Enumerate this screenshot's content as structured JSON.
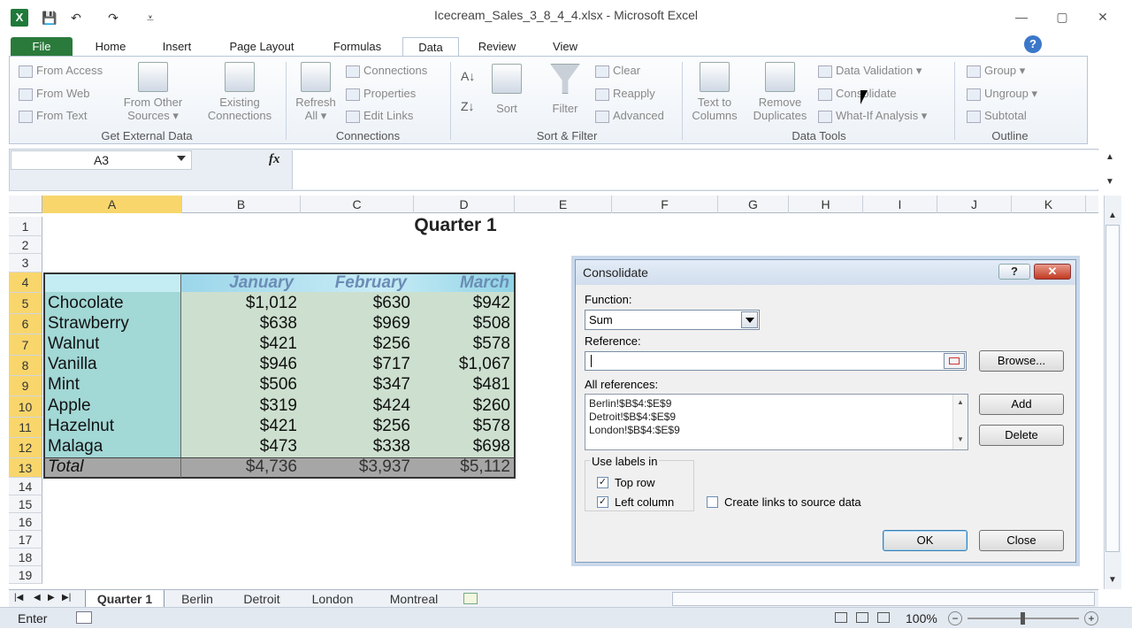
{
  "window": {
    "title": "Icecream_Sales_3_8_4_4.xlsx - Microsoft Excel",
    "minimize": "—",
    "maximize": "▢",
    "close": "✕"
  },
  "quick_access": {
    "save": "💾",
    "undo": "↶",
    "redo": "↷",
    "customize": "⩡"
  },
  "tabs": [
    "File",
    "Home",
    "Insert",
    "Page Layout",
    "Formulas",
    "Data",
    "Review",
    "View"
  ],
  "active_tab": "Data",
  "ribbon": {
    "get_external": {
      "items": [
        "From Access",
        "From Web",
        "From Text"
      ],
      "big1": [
        "From Other",
        "Sources ▾"
      ],
      "big2": [
        "Existing",
        "Connections"
      ],
      "label": "Get External Data"
    },
    "connections": {
      "big": [
        "Refresh",
        "All ▾"
      ],
      "items": [
        "Connections",
        "Properties",
        "Edit Links"
      ],
      "label": "Connections"
    },
    "sort_filter": {
      "sort": "Sort",
      "filter": "Filter",
      "items": [
        "Clear",
        "Reapply",
        "Advanced"
      ],
      "label": "Sort & Filter"
    },
    "data_tools": {
      "big1": [
        "Text to",
        "Columns"
      ],
      "big2": [
        "Remove",
        "Duplicates"
      ],
      "items": [
        "Data Validation ▾",
        "Consolidate",
        "What-If Analysis ▾"
      ],
      "label": "Data Tools"
    },
    "outline": {
      "items": [
        "Group ▾",
        "Ungroup ▾",
        "Subtotal"
      ],
      "label": "Outline"
    }
  },
  "formula_bar": {
    "name_box": "A3",
    "fx": "fx",
    "value": ""
  },
  "columns": [
    "A",
    "B",
    "C",
    "D",
    "E",
    "F",
    "G",
    "H",
    "I",
    "J",
    "K"
  ],
  "rows": [
    "1",
    "2",
    "3",
    "4",
    "5",
    "6",
    "7",
    "8",
    "9",
    "10",
    "11",
    "12",
    "13",
    "14",
    "15",
    "16",
    "17",
    "18",
    "19"
  ],
  "sheet": {
    "title": "Quarter 1",
    "headers": [
      "January",
      "February",
      "March"
    ],
    "data": [
      {
        "name": "Chocolate",
        "jan": "$1,012",
        "feb": "$630",
        "mar": "$942"
      },
      {
        "name": "Strawberry",
        "jan": "$638",
        "feb": "$969",
        "mar": "$508"
      },
      {
        "name": "Walnut",
        "jan": "$421",
        "feb": "$256",
        "mar": "$578"
      },
      {
        "name": "Vanilla",
        "jan": "$946",
        "feb": "$717",
        "mar": "$1,067"
      },
      {
        "name": "Mint",
        "jan": "$506",
        "feb": "$347",
        "mar": "$481"
      },
      {
        "name": "Apple",
        "jan": "$319",
        "feb": "$424",
        "mar": "$260"
      },
      {
        "name": "Hazelnut",
        "jan": "$421",
        "feb": "$256",
        "mar": "$578"
      },
      {
        "name": "Malaga",
        "jan": "$473",
        "feb": "$338",
        "mar": "$698"
      }
    ],
    "total": {
      "name": "Total",
      "jan": "$4,736",
      "feb": "$3,937",
      "mar": "$5,112"
    }
  },
  "sheet_tabs": [
    "Quarter 1",
    "Berlin",
    "Detroit",
    "London",
    "Montreal"
  ],
  "active_sheet": "Quarter 1",
  "status": {
    "mode": "Enter",
    "zoom": "100%"
  },
  "dialog": {
    "title": "Consolidate",
    "help": "?",
    "close": "✕",
    "function_label": "Function:",
    "function_value": "Sum",
    "reference_label": "Reference:",
    "reference_value": "",
    "browse": "Browse...",
    "all_refs_label": "All references:",
    "all_refs": [
      "Berlin!$B$4:$E$9",
      "Detroit!$B$4:$E$9",
      "London!$B$4:$E$9"
    ],
    "add": "Add",
    "delete": "Delete",
    "use_labels": "Use labels in",
    "top_row": "Top row",
    "left_column": "Left column",
    "create_links": "Create links to source data",
    "ok": "OK",
    "close_btn": "Close",
    "top_row_checked": true,
    "left_column_checked": true,
    "create_links_checked": false
  }
}
